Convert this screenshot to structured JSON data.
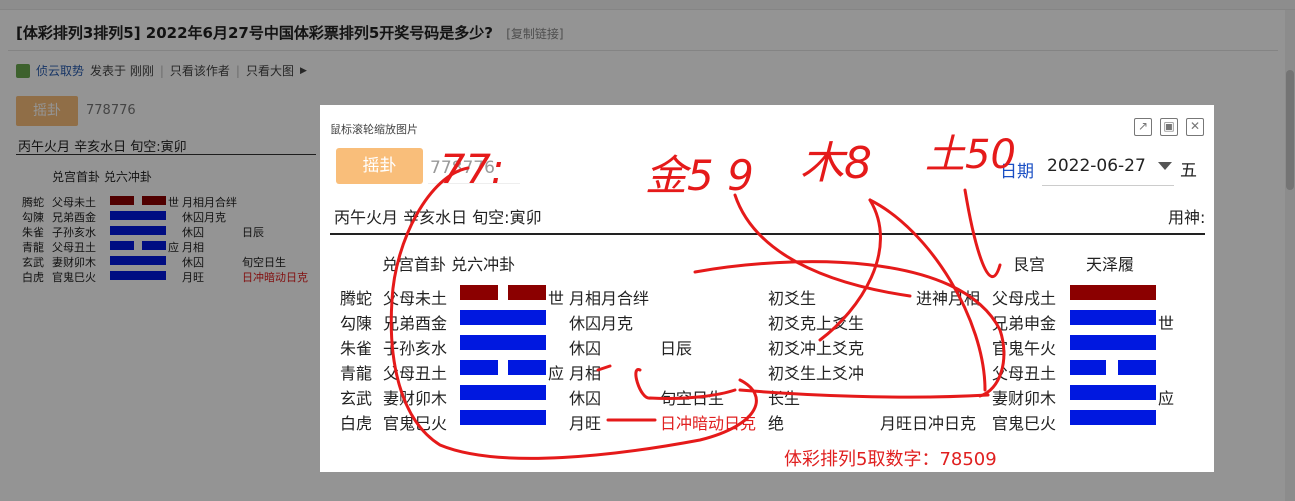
{
  "page": {
    "title": "[体彩排列3排列5] 2022年6月27号中国体彩票排列5开奖号码是多少?",
    "copy_link": "[复制链接]",
    "author": "侦云取势",
    "posted": "发表于 刚刚",
    "only_author": "只看该作者",
    "big_image": "只看大图",
    "sep": "|"
  },
  "background_card": {
    "shake_label": "摇卦",
    "number": "778776",
    "header": "丙午火月 辛亥水日 旬空:寅卯",
    "gua_names": "兑宫首卦  兑六冲卦",
    "rows": [
      {
        "spirit": "腾蛇",
        "relation": "父母未土",
        "mark": "世",
        "note": "月相月合绊",
        "extra": "",
        "clash": ""
      },
      {
        "spirit": "勾陳",
        "relation": "兄弟酉金",
        "mark": "",
        "note": "休囚月克",
        "extra": "",
        "clash": ""
      },
      {
        "spirit": "朱雀",
        "relation": "子孙亥水",
        "mark": "",
        "note": "休囚",
        "extra": "日辰",
        "clash": ""
      },
      {
        "spirit": "青龍",
        "relation": "父母丑土",
        "mark": "应",
        "note": "月相",
        "extra": "",
        "clash": ""
      },
      {
        "spirit": "玄武",
        "relation": "妻财卯木",
        "mark": "",
        "note": "休囚",
        "extra": "旬空日生",
        "clash": ""
      },
      {
        "spirit": "白虎",
        "relation": "官鬼巳火",
        "mark": "",
        "note": "月旺",
        "extra": "",
        "clash": "日冲暗动日克"
      }
    ]
  },
  "popup": {
    "hint": "鼠标滚轮缩放图片",
    "icons": [
      "external-link-icon",
      "restore-icon",
      "close-icon"
    ],
    "shake_label": "摇卦",
    "number_value": "778776",
    "date_label": "日期",
    "date_value": "2022-06-27",
    "date_cut": "五",
    "info": "丙午火月 辛亥水日 旬空:寅卯",
    "yongshen": "用神:",
    "gua_left": "兑宫首卦  兑六冲卦",
    "gua_palace": "艮宫",
    "gua_right": "天泽履",
    "rows": [
      {
        "spirit": "腾蛇",
        "relation": "父母未土",
        "line_type": "yin",
        "color": "#8b0000",
        "mark": "世",
        "state": "月相月合绊",
        "day": "",
        "change": "初爻生",
        "change_state": "进神月相",
        "right_relation": "父母戌土",
        "right_line": "yang",
        "right_color": "#8b0000",
        "right_mark": ""
      },
      {
        "spirit": "勾陳",
        "relation": "兄弟酉金",
        "line_type": "yang",
        "color": "#0018e0",
        "mark": "",
        "state": "休囚月克",
        "day": "",
        "change": "初爻克上爻生",
        "change_state": "",
        "right_relation": "兄弟申金",
        "right_line": "yang",
        "right_color": "#0018e0",
        "right_mark": "世"
      },
      {
        "spirit": "朱雀",
        "relation": "子孙亥水",
        "line_type": "yang",
        "color": "#0018e0",
        "mark": "",
        "state": "休囚",
        "day": "日辰",
        "change": "初爻冲上爻克",
        "change_state": "",
        "right_relation": "官鬼午火",
        "right_line": "yang",
        "right_color": "#0018e0",
        "right_mark": ""
      },
      {
        "spirit": "青龍",
        "relation": "父母丑土",
        "line_type": "yin",
        "color": "#0018e0",
        "mark": "应",
        "state": "月相",
        "day": "",
        "change": "初爻生上爻冲",
        "change_state": "",
        "right_relation": "父母丑土",
        "right_line": "yin",
        "right_color": "#0018e0",
        "right_mark": ""
      },
      {
        "spirit": "玄武",
        "relation": "妻财卯木",
        "line_type": "yang",
        "color": "#0018e0",
        "mark": "",
        "state": "休囚",
        "day": "旬空日生",
        "change": "长生",
        "change_state": "",
        "right_relation": "妻财卯木",
        "right_line": "yang",
        "right_color": "#0018e0",
        "right_mark": "应"
      },
      {
        "spirit": "白虎",
        "relation": "官鬼巳火",
        "line_type": "yang",
        "color": "#0018e0",
        "mark": "",
        "state": "月旺",
        "day": "日冲暗动日克",
        "change": "绝",
        "change_state": "月旺日冲日克",
        "right_relation": "官鬼巳火",
        "right_line": "yang",
        "right_color": "#0018e0",
        "right_mark": ""
      }
    ],
    "summary": "体彩排列5取数字：78509"
  },
  "handwriting": {
    "color": "#e51a1a",
    "scribble_1": "77:",
    "scribble_2": "金5 9",
    "scribble_3": "木8",
    "scribble_4": "土50"
  }
}
